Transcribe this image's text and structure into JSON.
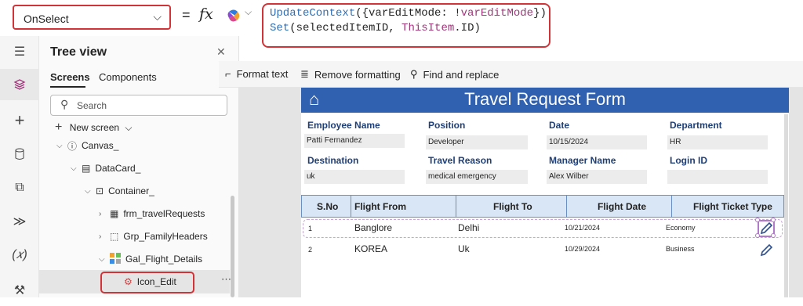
{
  "formula_bar": {
    "property": "OnSelect",
    "equals": "=",
    "fx": "fx",
    "formula_line1": {
      "fn": "UpdateContext",
      "text": "({varEditMode: !",
      "kw": "varEditMode",
      "end": "})"
    },
    "formula_line2": {
      "fn": "Set",
      "text": "(selectedItemID, ",
      "kw": "ThisItem",
      "end": ".ID)"
    }
  },
  "tree_view": {
    "title": "Tree view",
    "tabs": [
      "Screens",
      "Components"
    ],
    "search_placeholder": "Search",
    "new_screen": "New screen",
    "nodes": [
      "Canvas_",
      "DataCard_",
      "Container_",
      "frm_travelRequests",
      "Grp_FamilyHeaders",
      "Gal_Flight_Details",
      "Icon_Edit"
    ]
  },
  "toolbar": {
    "format_text": "Format text",
    "remove_formatting": "Remove formatting",
    "find_replace": "Find and replace"
  },
  "app": {
    "title": "Travel Request Form",
    "fields": [
      {
        "label": "Employee Name",
        "value": "Patti Fernandez"
      },
      {
        "label": "Position",
        "value": "Developer"
      },
      {
        "label": "Date",
        "value": "10/15/2024"
      },
      {
        "label": "Department",
        "value": "HR"
      },
      {
        "label": "Destination",
        "value": "uk"
      },
      {
        "label": "Travel Reason",
        "value": "medical emergency"
      },
      {
        "label": "Manager Name",
        "value": "Alex Wilber"
      },
      {
        "label": "Login ID",
        "value": ""
      }
    ],
    "grid": {
      "headers": [
        "S.No",
        "Flight From",
        "Flight To",
        "Flight Date",
        "Flight Ticket Type"
      ],
      "rows": [
        {
          "sno": "1",
          "from": "Banglore",
          "to": "Delhi",
          "date": "10/21/2024",
          "type": "Economy"
        },
        {
          "sno": "2",
          "from": "KOREA",
          "to": "Uk",
          "date": "10/29/2024",
          "type": "Business"
        }
      ]
    }
  },
  "colors": {
    "header_blue": "#3060b0",
    "highlight_red": "#d13438"
  }
}
